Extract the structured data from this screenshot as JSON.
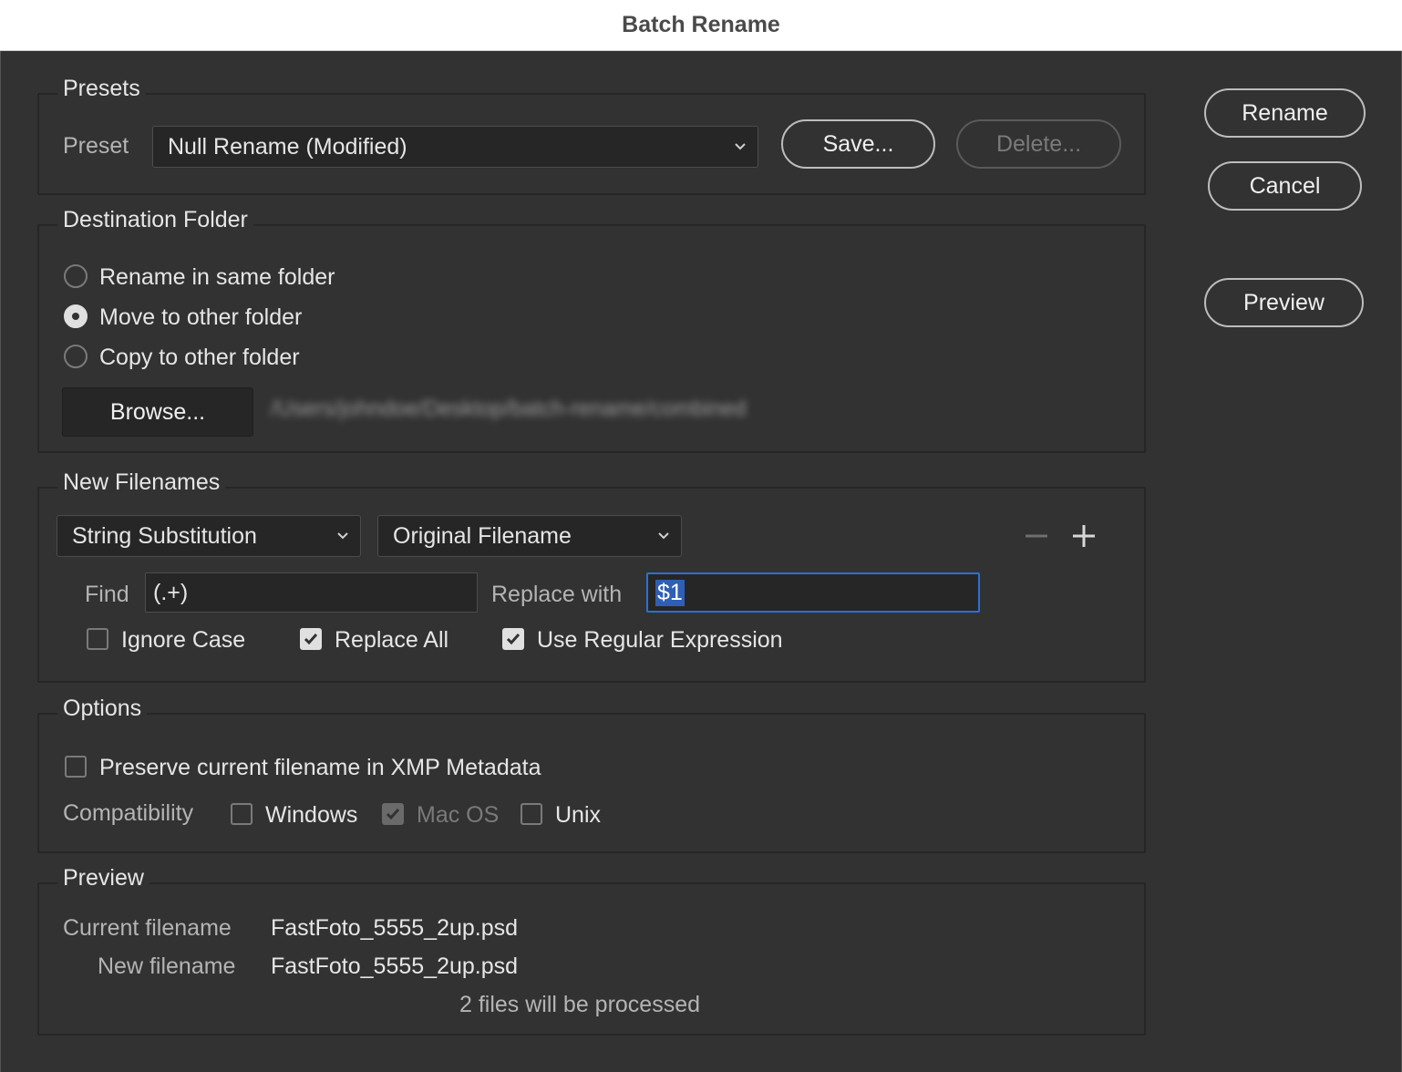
{
  "window": {
    "title": "Batch Rename"
  },
  "actions": {
    "rename": "Rename",
    "cancel": "Cancel",
    "preview": "Preview"
  },
  "presets": {
    "title": "Presets",
    "preset_label": "Preset",
    "selected": "Null Rename (Modified)",
    "save": "Save...",
    "delete": "Delete..."
  },
  "destination": {
    "title": "Destination Folder",
    "options": [
      "Rename in same folder",
      "Move to other folder",
      "Copy to other folder"
    ],
    "selected_index": 1,
    "browse": "Browse...",
    "path": "/Users/johndoe/Desktop/batch-rename/combined"
  },
  "new_filenames": {
    "title": "New Filenames",
    "type": "String Substitution",
    "source": "Original Filename",
    "find_label": "Find",
    "find_value": "(.+)",
    "replace_label": "Replace with",
    "replace_value": "$1",
    "ignore_case": "Ignore Case",
    "replace_all": "Replace All",
    "use_regex": "Use Regular Expression",
    "minus_icon": "minus-icon",
    "plus_icon": "plus-icon"
  },
  "options": {
    "title": "Options",
    "preserve": "Preserve current filename in XMP Metadata",
    "compat_label": "Compatibility",
    "windows": "Windows",
    "macos": "Mac OS",
    "unix": "Unix"
  },
  "preview": {
    "title": "Preview",
    "current_label": "Current filename",
    "current_value": "FastFoto_5555_2up.psd",
    "new_label": "New filename",
    "new_value": "FastFoto_5555_2up.psd",
    "count": "2 files will be processed"
  },
  "colors": {
    "background": "#323232",
    "focus": "#2a70d6",
    "selection": "#2e5fb5"
  }
}
